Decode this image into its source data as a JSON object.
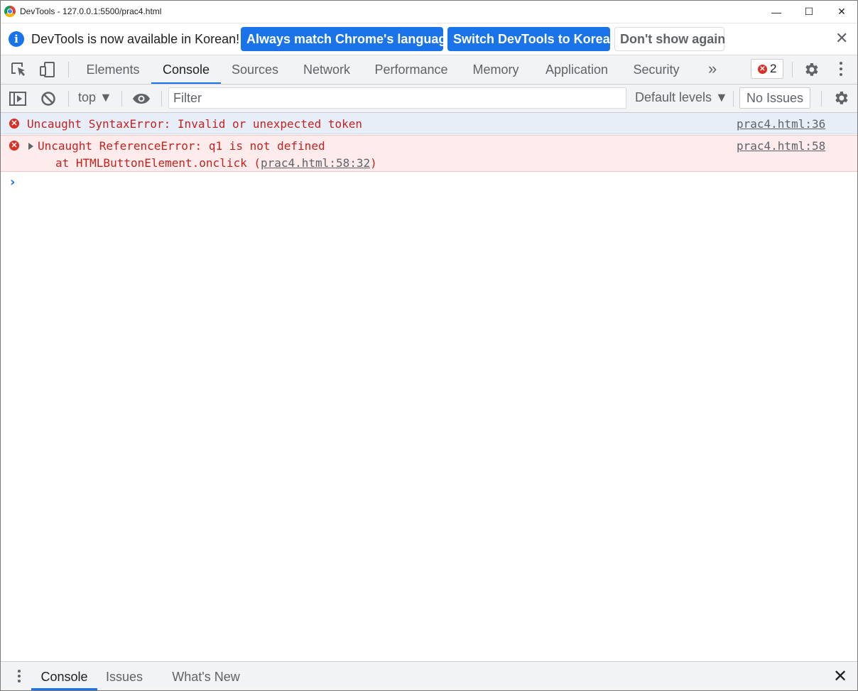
{
  "window": {
    "title": "DevTools - 127.0.0.1:5500/prac4.html",
    "minimize_glyph": "—",
    "maximize_glyph": "☐",
    "close_glyph": "✕"
  },
  "infobar": {
    "icon_glyph": "i",
    "message": "DevTools is now available in Korean!",
    "buttons": [
      "Always match Chrome's language",
      "Switch DevTools to Korean",
      "Don't show again"
    ],
    "close_glyph": "✕"
  },
  "tabs": {
    "items": [
      "Elements",
      "Console",
      "Sources",
      "Network",
      "Performance",
      "Memory",
      "Application",
      "Security"
    ],
    "active": "Console",
    "more_glyph": "»",
    "error_count": "2",
    "error_glyph": "✕"
  },
  "console_toolbar": {
    "context": "top ▼",
    "filter_placeholder": "Filter",
    "levels": "Default levels ▼",
    "issues": "No Issues"
  },
  "messages": [
    {
      "icon": "✕",
      "text": "Uncaught SyntaxError: Invalid or unexpected token",
      "source": "prac4.html:36"
    },
    {
      "icon": "✕",
      "text": "Uncaught ReferenceError: q1 is not defined",
      "stack_prefix": "at HTMLButtonElement.onclick (",
      "stack_link": "prac4.html:58:32",
      "stack_suffix": ")",
      "source": "prac4.html:58"
    }
  ],
  "prompt_glyph": "›",
  "drawer": {
    "tabs": [
      "Console",
      "Issues",
      "What's New"
    ],
    "active": "Console",
    "close_glyph": "✕"
  },
  "colors": {
    "accent": "#1a73e8",
    "error": "#d93025",
    "error_text": "#c5221f",
    "error_row_bg": "#fdeceb",
    "selected_row_bg": "#e8eef8",
    "toolbar_bg": "#f1f3f4"
  }
}
